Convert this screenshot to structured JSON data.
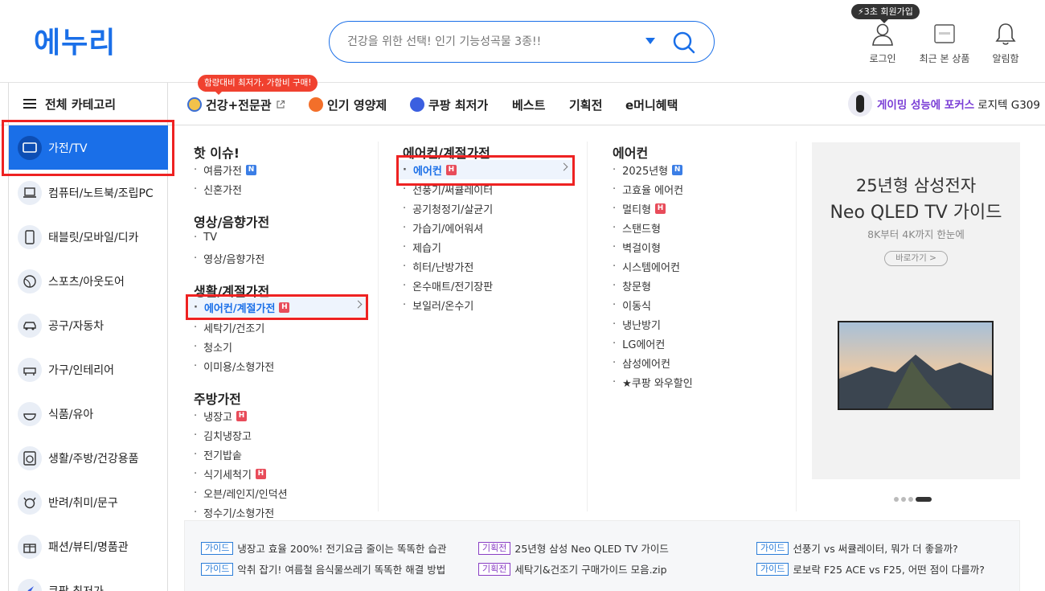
{
  "header": {
    "logo": "에누리",
    "search": {
      "value": "",
      "placeholder": "건강을 위한 선택! 인기 기능성곡물 3종!!"
    },
    "join_badge": "⚡3초 회원가입",
    "utils": [
      {
        "label": "로그인",
        "icon": "user-icon"
      },
      {
        "label": "최근 본 상품",
        "icon": "recent-box-icon"
      },
      {
        "label": "알림함",
        "icon": "bell-icon"
      }
    ]
  },
  "category_bar": {
    "all_label": "전체 카테고리",
    "promo_tag": "함량대비 최저가, 가함비 구매!",
    "tabs": [
      {
        "label": "건강+전문관",
        "icon": "health-globe-icon",
        "external": true
      },
      {
        "label": "인기 영양제",
        "icon": "thumbs-up-icon"
      },
      {
        "label": "쿠팡 최저가",
        "icon": "rocket-icon"
      },
      {
        "label": "베스트"
      },
      {
        "label": "기획전"
      },
      {
        "label": "e머니혜택"
      }
    ],
    "ad": {
      "highlight": "게이밍 성능에 포커스",
      "rest": "로지텍 G309"
    }
  },
  "sidebar": {
    "items": [
      {
        "label": "가전/TV",
        "icon": "tv-icon",
        "active": true
      },
      {
        "label": "컴퓨터/노트북/조립PC",
        "icon": "laptop-icon"
      },
      {
        "label": "태블릿/모바일/디카",
        "icon": "tablet-icon"
      },
      {
        "label": "스포츠/아웃도어",
        "icon": "ball-icon"
      },
      {
        "label": "공구/자동차",
        "icon": "car-icon"
      },
      {
        "label": "가구/인테리어",
        "icon": "furniture-icon"
      },
      {
        "label": "식품/유아",
        "icon": "food-icon"
      },
      {
        "label": "생활/주방/건강용품",
        "icon": "washer-icon"
      },
      {
        "label": "반려/취미/문구",
        "icon": "pet-icon"
      },
      {
        "label": "패션/뷰티/명품관",
        "icon": "gift-icon"
      },
      {
        "label": "쿠팡 최저가",
        "icon": "rocket-icon"
      }
    ]
  },
  "menu": {
    "col1": {
      "groups": [
        {
          "title": "핫 이슈!",
          "items": [
            {
              "label": "여름가전",
              "badge": "N"
            },
            {
              "label": "신혼가전"
            }
          ]
        },
        {
          "title": "영상/음향가전",
          "items": [
            {
              "label": "TV"
            },
            {
              "label": "영상/음향가전"
            }
          ]
        },
        {
          "title": "생활/계절가전",
          "items": [
            {
              "label": "에어컨/계절가전",
              "badge": "H",
              "selected": true
            },
            {
              "label": "세탁기/건조기"
            },
            {
              "label": "청소기"
            },
            {
              "label": "이미용/소형가전"
            }
          ]
        },
        {
          "title": "주방가전",
          "items": [
            {
              "label": "냉장고",
              "badge": "H"
            },
            {
              "label": "김치냉장고"
            },
            {
              "label": "전기밥솥"
            },
            {
              "label": "식기세척기",
              "badge": "H"
            },
            {
              "label": "오븐/레인지/인덕션"
            },
            {
              "label": "정수기/소형가전"
            }
          ]
        }
      ]
    },
    "col2": {
      "title": "에어컨/계절가전",
      "items": [
        {
          "label": "에어컨",
          "badge": "H",
          "selected": true
        },
        {
          "label": "선풍기/써큘레이터"
        },
        {
          "label": "공기청정기/살균기"
        },
        {
          "label": "가습기/에어워셔"
        },
        {
          "label": "제습기"
        },
        {
          "label": "히터/난방가전"
        },
        {
          "label": "온수매트/전기장판"
        },
        {
          "label": "보일러/온수기"
        }
      ]
    },
    "col3": {
      "title": "에어컨",
      "items": [
        {
          "label": "2025년형",
          "badge": "N"
        },
        {
          "label": "고효율 에어컨"
        },
        {
          "label": "멀티형",
          "badge": "H"
        },
        {
          "label": "스탠드형"
        },
        {
          "label": "벽걸이형"
        },
        {
          "label": "시스템에어컨"
        },
        {
          "label": "창문형"
        },
        {
          "label": "이동식"
        },
        {
          "label": "냉난방기"
        },
        {
          "label": "LG에어컨"
        },
        {
          "label": "삼성에어컨"
        },
        {
          "label": "★쿠팡 와우할인"
        }
      ]
    }
  },
  "banner": {
    "title_1": "25년형 삼성전자",
    "title_2": "Neo QLED TV 가이드",
    "subtitle": "8K부터 4K까지 한눈에",
    "button": "바로가기 >",
    "page_index": 4,
    "page_count": 4
  },
  "guides": [
    {
      "tag": "가이드",
      "kind": "guide",
      "text": "냉장고 효율 200%! 전기요금 줄이는 똑똑한 습관"
    },
    {
      "tag": "기획전",
      "kind": "plan",
      "text": "25년형 삼성 Neo QLED TV 가이드"
    },
    {
      "tag": "가이드",
      "kind": "guide",
      "text": "선풍기 vs 써큘레이터, 뭐가 더 좋을까?"
    },
    {
      "tag": "가이드",
      "kind": "guide",
      "text": "악취 잡기! 여름철 음식물쓰레기 똑똑한 해결 방법"
    },
    {
      "tag": "기획전",
      "kind": "plan",
      "text": "세탁기&건조기 구매가이드 모음.zip"
    },
    {
      "tag": "가이드",
      "kind": "guide",
      "text": "로보락 F25 ACE vs F25, 어떤 점이 다를까?"
    }
  ],
  "colors": {
    "brand": "#1a6fe8",
    "hot_badge": "#e84c5a",
    "new_badge": "#3b7ee6",
    "promo": "#f0412f",
    "highlight_box": "#ee2222"
  }
}
